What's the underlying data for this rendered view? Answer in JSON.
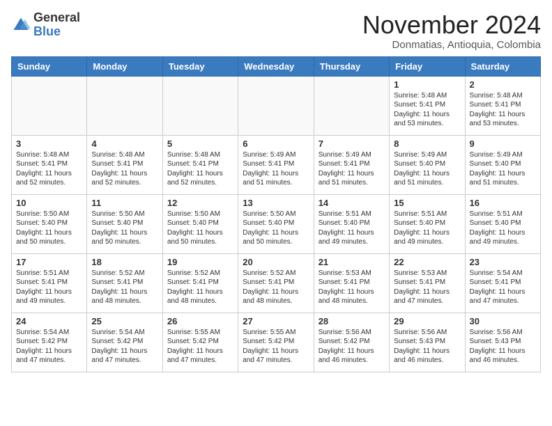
{
  "header": {
    "logo_general": "General",
    "logo_blue": "Blue",
    "month_title": "November 2024",
    "location": "Donmatias, Antioquia, Colombia"
  },
  "calendar": {
    "days_of_week": [
      "Sunday",
      "Monday",
      "Tuesday",
      "Wednesday",
      "Thursday",
      "Friday",
      "Saturday"
    ],
    "weeks": [
      [
        {
          "day": "",
          "info": ""
        },
        {
          "day": "",
          "info": ""
        },
        {
          "day": "",
          "info": ""
        },
        {
          "day": "",
          "info": ""
        },
        {
          "day": "",
          "info": ""
        },
        {
          "day": "1",
          "info": "Sunrise: 5:48 AM\nSunset: 5:41 PM\nDaylight: 11 hours\nand 53 minutes."
        },
        {
          "day": "2",
          "info": "Sunrise: 5:48 AM\nSunset: 5:41 PM\nDaylight: 11 hours\nand 53 minutes."
        }
      ],
      [
        {
          "day": "3",
          "info": "Sunrise: 5:48 AM\nSunset: 5:41 PM\nDaylight: 11 hours\nand 52 minutes."
        },
        {
          "day": "4",
          "info": "Sunrise: 5:48 AM\nSunset: 5:41 PM\nDaylight: 11 hours\nand 52 minutes."
        },
        {
          "day": "5",
          "info": "Sunrise: 5:48 AM\nSunset: 5:41 PM\nDaylight: 11 hours\nand 52 minutes."
        },
        {
          "day": "6",
          "info": "Sunrise: 5:49 AM\nSunset: 5:41 PM\nDaylight: 11 hours\nand 51 minutes."
        },
        {
          "day": "7",
          "info": "Sunrise: 5:49 AM\nSunset: 5:41 PM\nDaylight: 11 hours\nand 51 minutes."
        },
        {
          "day": "8",
          "info": "Sunrise: 5:49 AM\nSunset: 5:40 PM\nDaylight: 11 hours\nand 51 minutes."
        },
        {
          "day": "9",
          "info": "Sunrise: 5:49 AM\nSunset: 5:40 PM\nDaylight: 11 hours\nand 51 minutes."
        }
      ],
      [
        {
          "day": "10",
          "info": "Sunrise: 5:50 AM\nSunset: 5:40 PM\nDaylight: 11 hours\nand 50 minutes."
        },
        {
          "day": "11",
          "info": "Sunrise: 5:50 AM\nSunset: 5:40 PM\nDaylight: 11 hours\nand 50 minutes."
        },
        {
          "day": "12",
          "info": "Sunrise: 5:50 AM\nSunset: 5:40 PM\nDaylight: 11 hours\nand 50 minutes."
        },
        {
          "day": "13",
          "info": "Sunrise: 5:50 AM\nSunset: 5:40 PM\nDaylight: 11 hours\nand 50 minutes."
        },
        {
          "day": "14",
          "info": "Sunrise: 5:51 AM\nSunset: 5:40 PM\nDaylight: 11 hours\nand 49 minutes."
        },
        {
          "day": "15",
          "info": "Sunrise: 5:51 AM\nSunset: 5:40 PM\nDaylight: 11 hours\nand 49 minutes."
        },
        {
          "day": "16",
          "info": "Sunrise: 5:51 AM\nSunset: 5:40 PM\nDaylight: 11 hours\nand 49 minutes."
        }
      ],
      [
        {
          "day": "17",
          "info": "Sunrise: 5:51 AM\nSunset: 5:41 PM\nDaylight: 11 hours\nand 49 minutes."
        },
        {
          "day": "18",
          "info": "Sunrise: 5:52 AM\nSunset: 5:41 PM\nDaylight: 11 hours\nand 48 minutes."
        },
        {
          "day": "19",
          "info": "Sunrise: 5:52 AM\nSunset: 5:41 PM\nDaylight: 11 hours\nand 48 minutes."
        },
        {
          "day": "20",
          "info": "Sunrise: 5:52 AM\nSunset: 5:41 PM\nDaylight: 11 hours\nand 48 minutes."
        },
        {
          "day": "21",
          "info": "Sunrise: 5:53 AM\nSunset: 5:41 PM\nDaylight: 11 hours\nand 48 minutes."
        },
        {
          "day": "22",
          "info": "Sunrise: 5:53 AM\nSunset: 5:41 PM\nDaylight: 11 hours\nand 47 minutes."
        },
        {
          "day": "23",
          "info": "Sunrise: 5:54 AM\nSunset: 5:41 PM\nDaylight: 11 hours\nand 47 minutes."
        }
      ],
      [
        {
          "day": "24",
          "info": "Sunrise: 5:54 AM\nSunset: 5:42 PM\nDaylight: 11 hours\nand 47 minutes."
        },
        {
          "day": "25",
          "info": "Sunrise: 5:54 AM\nSunset: 5:42 PM\nDaylight: 11 hours\nand 47 minutes."
        },
        {
          "day": "26",
          "info": "Sunrise: 5:55 AM\nSunset: 5:42 PM\nDaylight: 11 hours\nand 47 minutes."
        },
        {
          "day": "27",
          "info": "Sunrise: 5:55 AM\nSunset: 5:42 PM\nDaylight: 11 hours\nand 47 minutes."
        },
        {
          "day": "28",
          "info": "Sunrise: 5:56 AM\nSunset: 5:42 PM\nDaylight: 11 hours\nand 46 minutes."
        },
        {
          "day": "29",
          "info": "Sunrise: 5:56 AM\nSunset: 5:43 PM\nDaylight: 11 hours\nand 46 minutes."
        },
        {
          "day": "30",
          "info": "Sunrise: 5:56 AM\nSunset: 5:43 PM\nDaylight: 11 hours\nand 46 minutes."
        }
      ]
    ]
  }
}
